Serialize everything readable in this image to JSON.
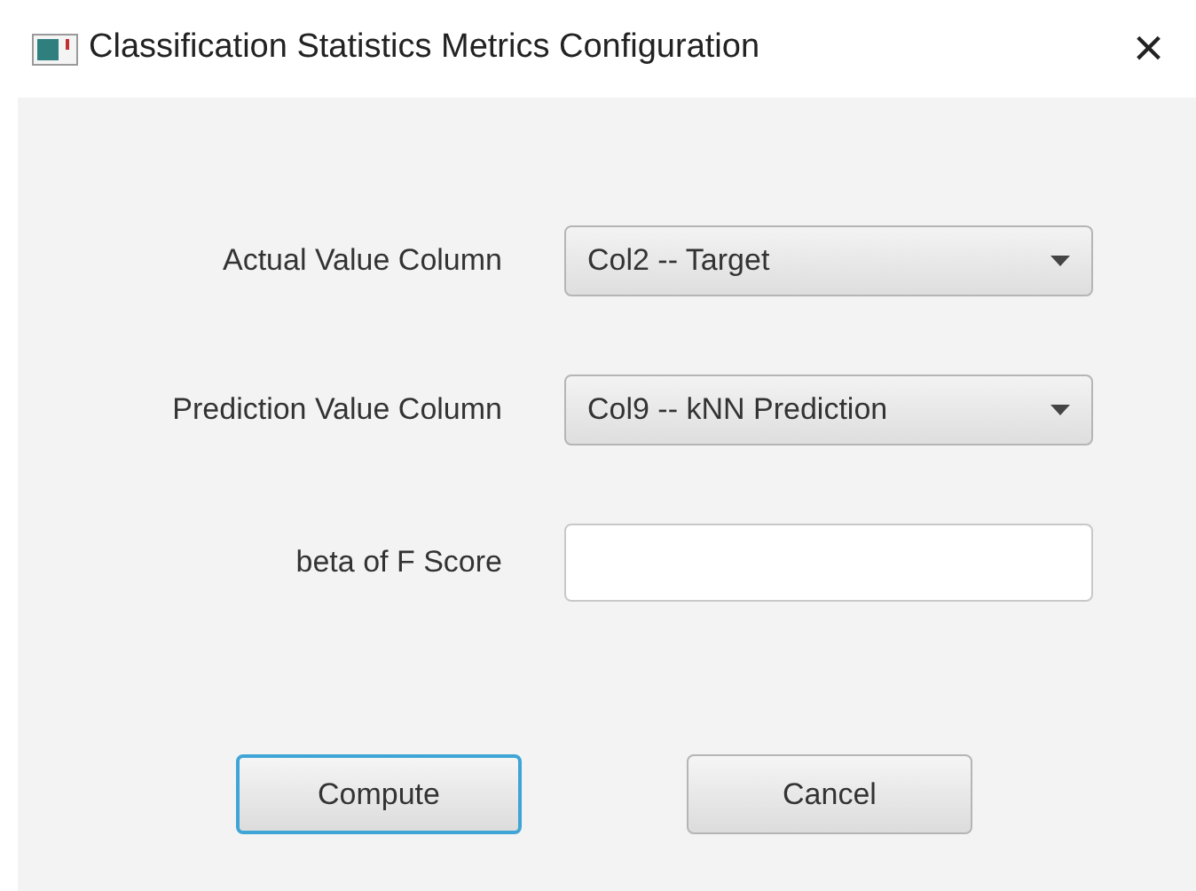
{
  "window": {
    "title": "Classification Statistics Metrics Configuration",
    "close": "×"
  },
  "fields": [
    {
      "label": "Actual Value Column",
      "kind": "dropdown",
      "value": "Col2 -- Target"
    },
    {
      "label": "Prediction Value Column",
      "kind": "dropdown",
      "value": "Col9 -- kNN Prediction"
    },
    {
      "label": "beta of F Score",
      "kind": "text"
    }
  ],
  "buttons": [
    {
      "label": "Compute",
      "focused": true
    },
    {
      "label": "Cancel",
      "focused": false
    }
  ]
}
